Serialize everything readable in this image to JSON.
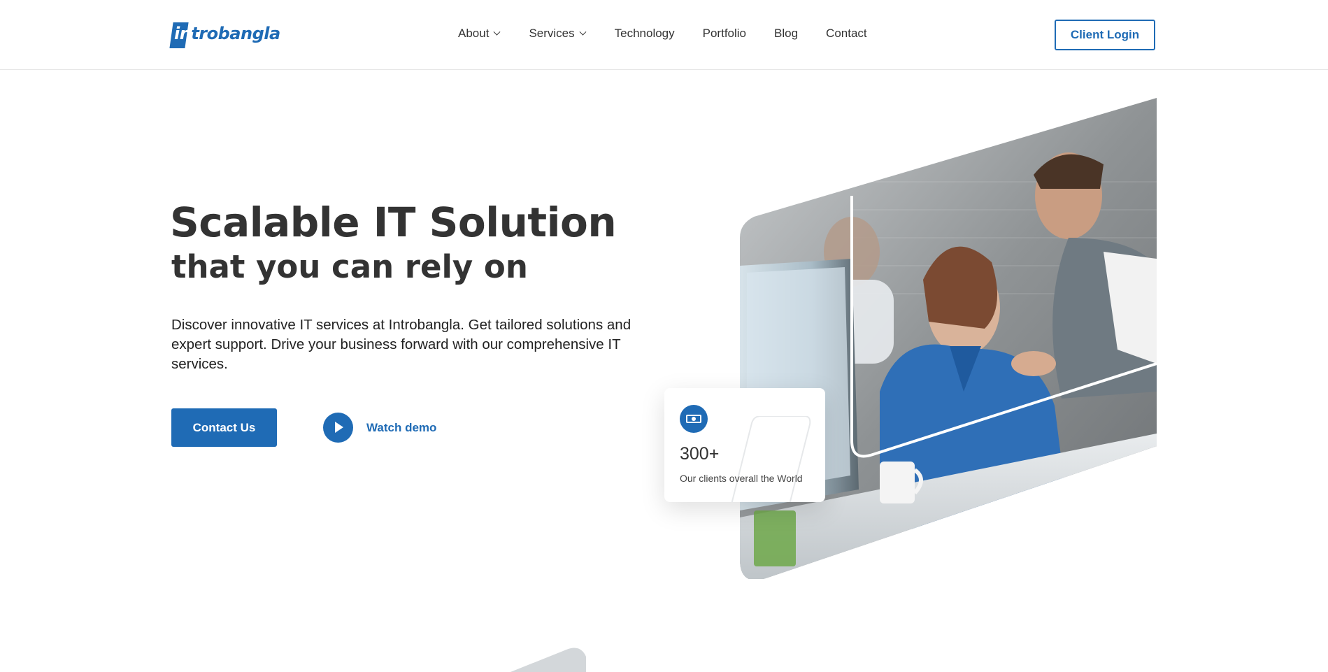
{
  "header": {
    "logo_text": "introbangla",
    "nav": [
      {
        "label": "About",
        "has_dropdown": true
      },
      {
        "label": "Services",
        "has_dropdown": true
      },
      {
        "label": "Technology",
        "has_dropdown": false
      },
      {
        "label": "Portfolio",
        "has_dropdown": false
      },
      {
        "label": "Blog",
        "has_dropdown": false
      },
      {
        "label": "Contact",
        "has_dropdown": false
      }
    ],
    "login_label": "Client Login"
  },
  "hero": {
    "title": "Scalable IT Solution",
    "subtitle": "that you can rely on",
    "description": "Discover innovative IT services at Introbangla. Get tailored solutions and expert support. Drive your business forward with our comprehensive IT services.",
    "contact_label": "Contact Us",
    "watch_label": "Watch demo",
    "image_icon": "office-team-photo"
  },
  "stat": {
    "icon": "money-icon",
    "value": "300+",
    "label": "Our clients overall the World"
  },
  "colors": {
    "brand": "#1f6bb5",
    "text": "#333333",
    "background": "#ffffff"
  }
}
